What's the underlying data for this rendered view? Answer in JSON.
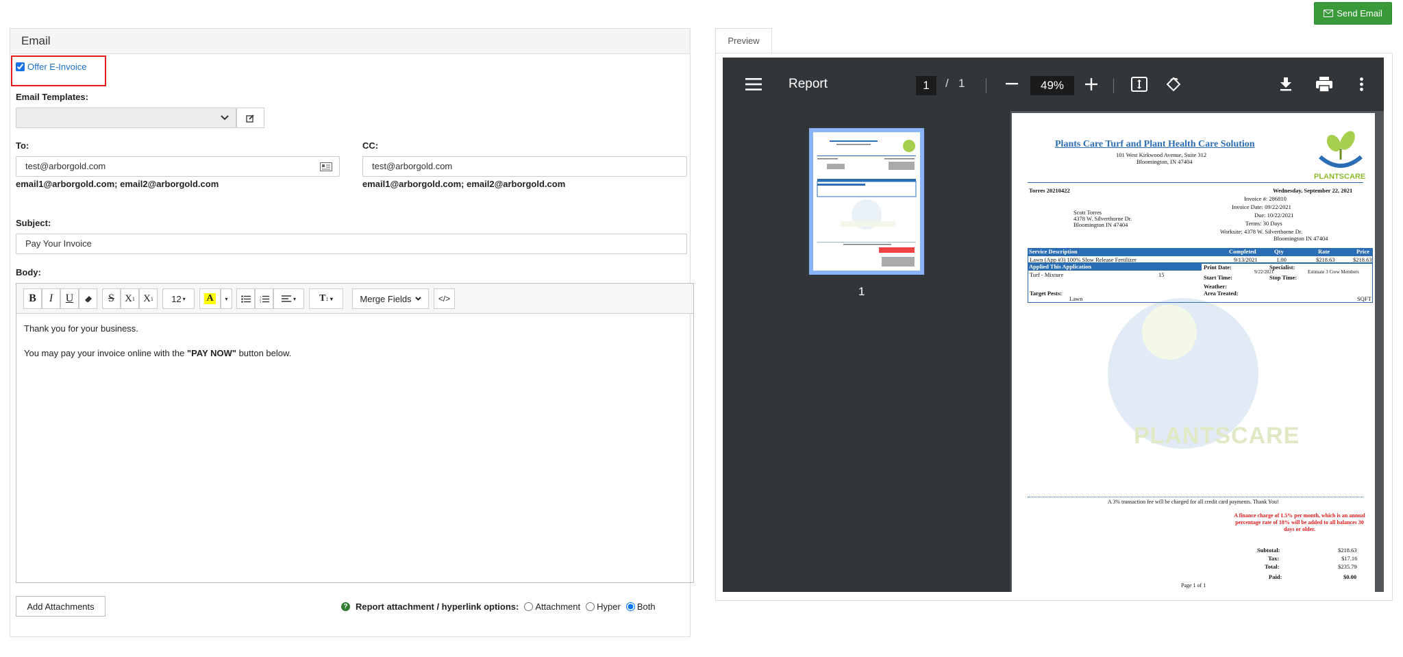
{
  "actions": {
    "send_email_label": "Send Email"
  },
  "email": {
    "panel_title": "Email",
    "offer_einvoice_label": "Offer E-Invoice",
    "offer_einvoice_checked": true,
    "templates_label": "Email Templates:",
    "to_label": "To:",
    "to_placeholder": "test@arborgold.com",
    "to_hint": "email1@arborgold.com; email2@arborgold.com",
    "cc_label": "CC:",
    "cc_placeholder": "test@arborgold.com",
    "cc_hint": "email1@arborgold.com; email2@arborgold.com",
    "subject_label": "Subject:",
    "subject_value": "Pay Your Invoice",
    "body_label": "Body:",
    "toolbar": {
      "font_size": "12",
      "merge_fields": "Merge Fields"
    },
    "body_line1": "Thank you for your business.",
    "body_line2_prefix": "You may pay your invoice online with the ",
    "body_line2_bold": "\"PAY NOW\"",
    "body_line2_suffix": " button below.",
    "add_attachments_label": "Add Attachments",
    "report_options_label": "Report attachment / hyperlink options:",
    "option_attachment": "Attachment",
    "option_hyper": "Hyper",
    "option_both": "Both",
    "selected_option": "Both"
  },
  "preview": {
    "tab_label": "Preview",
    "viewer_title": "Report",
    "page_current": "1",
    "page_separator": "/",
    "page_total": "1",
    "zoom": "49%",
    "thumb_page_label": "1",
    "doc": {
      "company": "Plants Care Turf and Plant Health Care Solution",
      "address1": "101 West Kirkwood Avenue, Suite 312",
      "address2": "Bloomington, IN 47404",
      "logo_text": "PLANTSCARE",
      "ref": "Torres 20210422",
      "date": "Wednesday, September 22, 2021",
      "invoice_no": "Invoice #: 286810",
      "invoice_date": "Invoice Date: 09/22/2021",
      "due": "Due: 10/22/2021",
      "terms": "Terms: 30 Days",
      "worksite1": "Worksite: 4378 W. Silverthorne Dr.",
      "worksite2": "Bloomington IN 47404",
      "client1": "Scott Torres",
      "client2": "4378 W. Silverthorne Dr.",
      "client3": "Bloomington IN 47404",
      "col_service": "Service Description",
      "col_completed": "Completed",
      "col_qty": "Qty",
      "col_rate": "Rate",
      "col_price": "Price",
      "row_service": "Lawn (App #3) 100% Slow Release Fertilizer",
      "row_completed": "9/13/2021",
      "row_qty": "1.00",
      "row_rate": "$218.63",
      "row_price": "$218.63",
      "applied_header": "Applied This Application",
      "applied_item": "Turf - Mixture",
      "applied_qty": "15",
      "print_date": "Print Date:",
      "print_date_val": "9/22/2021",
      "specialist": "Specialist:",
      "specialist_val": "Estimate 3 Crew Members",
      "start_time": "Start Time:",
      "stop_time": "Stop Time:",
      "weather": "Weather:",
      "target_pests": "Target Pests:",
      "target_val": "Lawn",
      "area_treated": "Area Treated:",
      "area_val": "SQFT",
      "fee_note": "A 3% transaction fee will be charged for all credit card payments. Thank You!",
      "finance_note1": "A finance charge of 1.5% per month, which is an annual",
      "finance_note2": "percentage rate of 18% will be added to all balances 30",
      "finance_note3": "days or older.",
      "subtotal_label": "Subtotal:",
      "subtotal": "$218.63",
      "tax_label": "Tax:",
      "tax": "$17.16",
      "total_label": "Total:",
      "total": "$235.79",
      "paid_label": "Paid:",
      "paid": "$0.00",
      "page_footer": "Page 1 of 1"
    }
  },
  "colors": {
    "accent_green": "#3a9a3a",
    "highlight_red": "#e21a1a",
    "link_blue": "#1a6fc4",
    "doc_blue": "#2a6db5"
  }
}
